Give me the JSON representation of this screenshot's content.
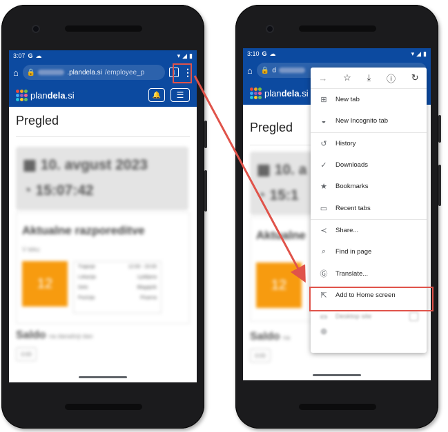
{
  "accent_red": "#e0534a",
  "brand_blue": "#0c4aa0",
  "left_phone": {
    "status": {
      "time": "3:07",
      "g_glyph": "G"
    },
    "url": {
      "host": ".plandela.si",
      "path": "/employee_p"
    },
    "tab_count": "1",
    "logo_prefix": "plan",
    "logo_bold": "dela",
    "logo_suffix": ".si",
    "page_title": "Pregled",
    "date_text": "10. avgust 2023",
    "time_text": "15:07:42",
    "section_title": "Aktualne razporeditve",
    "section_sub": "V teku",
    "day_number": "12",
    "detail_rows": [
      {
        "k": "Trajanje",
        "v": "12:00 - 20:00"
      },
      {
        "k": "Lokacija",
        "v": "Ljubljana"
      },
      {
        "k": "Delo",
        "v": "Blagajnik"
      },
      {
        "k": "Pozicija",
        "v": "Pisarna"
      }
    ],
    "saldo_title": "Saldo",
    "saldo_sub": "na današnji dan",
    "saldo_value": "0:00"
  },
  "right_phone": {
    "status": {
      "time": "3:10",
      "g_glyph": "G"
    },
    "url": {
      "host": "d"
    },
    "logo_prefix": "plan",
    "logo_bold": "dela",
    "logo_suffix": ".si",
    "page_title": "Pregled",
    "date_text": "10. a",
    "time_text": "15:1",
    "section_title": "Aktualne",
    "day_number": "12",
    "saldo_title": "Saldo",
    "saldo_sub": "na",
    "saldo_value": "0:00",
    "menu": {
      "items": [
        {
          "label": "New tab",
          "icon": "plus-box-icon"
        },
        {
          "label": "New Incognito tab",
          "icon": "incognito-icon"
        },
        {
          "label": "History",
          "icon": "history-icon"
        },
        {
          "label": "Downloads",
          "icon": "downloads-icon"
        },
        {
          "label": "Bookmarks",
          "icon": "star-icon"
        },
        {
          "label": "Recent tabs",
          "icon": "recent-tabs-icon"
        },
        {
          "label": "Share...",
          "icon": "share-icon"
        },
        {
          "label": "Find in page",
          "icon": "find-icon"
        },
        {
          "label": "Translate...",
          "icon": "translate-icon"
        },
        {
          "label": "Add to Home screen",
          "icon": "add-home-icon"
        },
        {
          "label": "Desktop site",
          "icon": "desktop-icon"
        }
      ]
    }
  }
}
